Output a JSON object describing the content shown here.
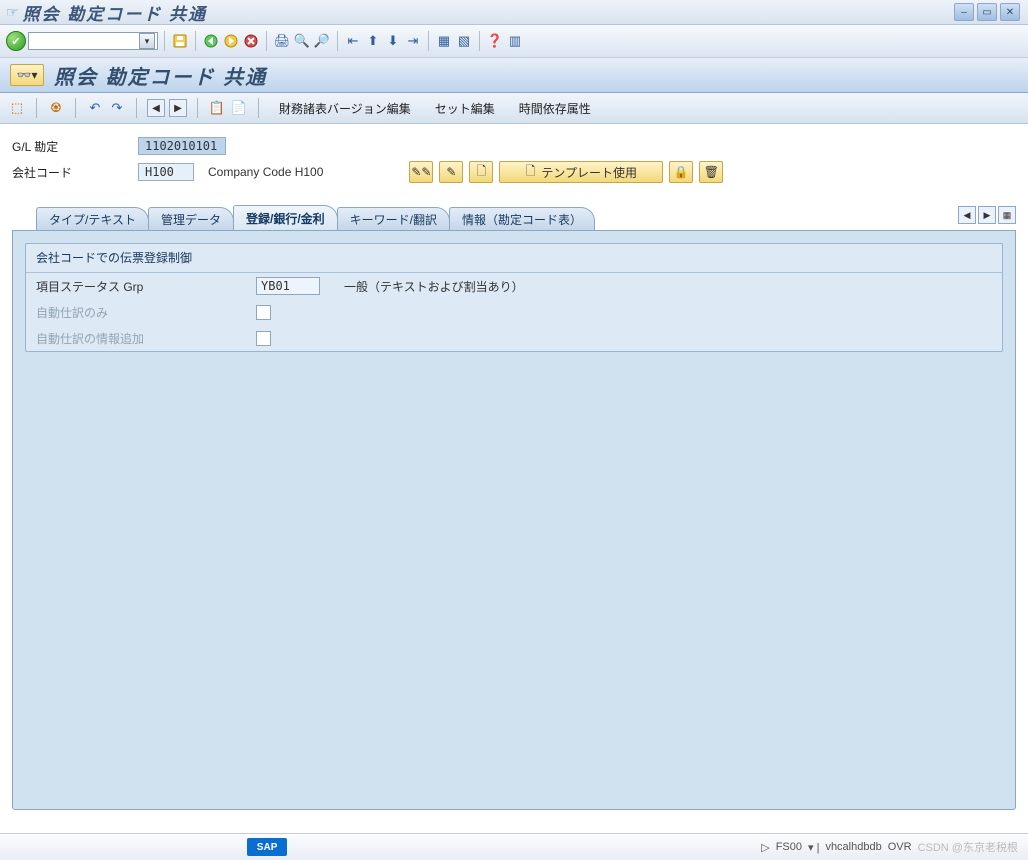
{
  "window": {
    "title": "照会 勘定コード 共通"
  },
  "page": {
    "title": "照会 勘定コード 共通"
  },
  "apptoolbar": {
    "link1": "財務諸表バージョン編集",
    "link2": "セット編集",
    "link3": "時間依存属性"
  },
  "fields": {
    "gl_label": "G/L 勘定",
    "gl_value": "1102010101",
    "cc_label": "会社コード",
    "cc_value": "H100",
    "cc_text": "Company Code H100",
    "template_btn": "テンプレート使用"
  },
  "tabs": {
    "t1": "タイプ/テキスト",
    "t2": "管理データ",
    "t3": "登録/銀行/金利",
    "t4": "キーワード/翻訳",
    "t5": "情報（勘定コード表）"
  },
  "group": {
    "title": "会社コードでの伝票登録制御",
    "row1_label": "項目ステータス Grp",
    "row1_value": "YB01",
    "row1_desc": "一般（テキストおよび割当あり）",
    "row2_label": "自動仕訳のみ",
    "row3_label": "自動仕訳の情報追加"
  },
  "status": {
    "sap": "SAP",
    "tx": "FS00",
    "host": "vhcalhdbdb",
    "ovr": "OVR",
    "watermark": "CSDN @东京老税根"
  }
}
